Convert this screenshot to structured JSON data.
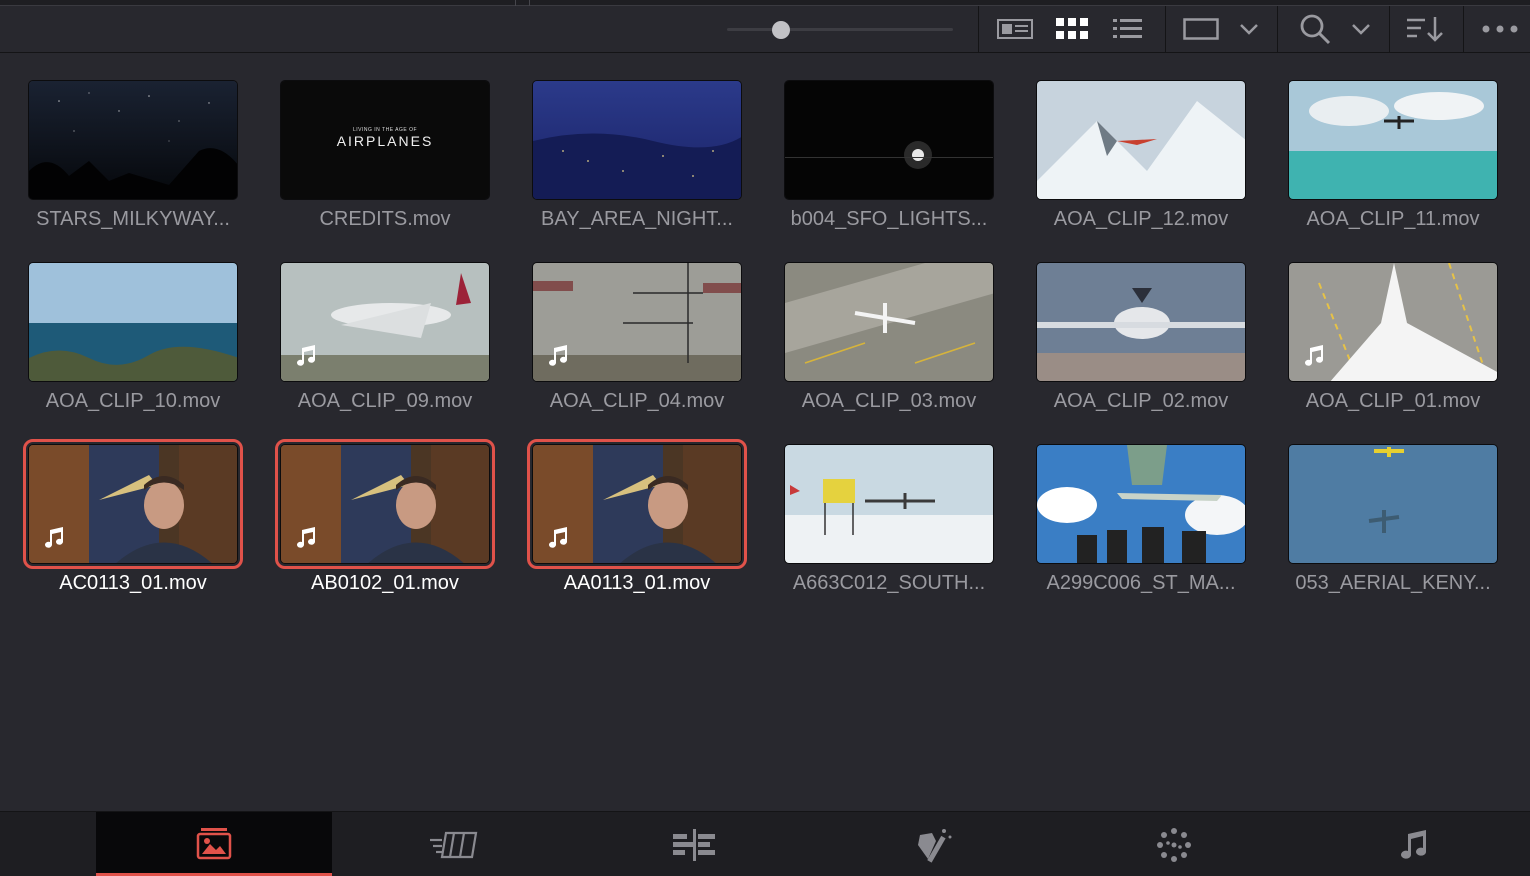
{
  "toolbar": {
    "zoom_slider_value": 0.25,
    "icons": [
      "metadata-view-icon",
      "thumbnail-view-icon",
      "list-view-icon",
      "clip-size-icon",
      "chevron-down-icon",
      "search-icon",
      "chevron-down-icon",
      "sort-icon",
      "more-options-icon"
    ]
  },
  "clips": [
    {
      "name": "STARS_MILKYWAY...",
      "audio": false,
      "selected": false,
      "scene": "night-stars"
    },
    {
      "name": "CREDITS.mov",
      "audio": false,
      "selected": false,
      "scene": "title-card",
      "title_small": "LIVING IN THE AGE OF",
      "title_big": "AIRPLANES"
    },
    {
      "name": "BAY_AREA_NIGHT...",
      "audio": false,
      "selected": false,
      "scene": "bay-night"
    },
    {
      "name": "b004_SFO_LIGHTS...",
      "audio": false,
      "selected": false,
      "scene": "dark-lights"
    },
    {
      "name": "AOA_CLIP_12.mov",
      "audio": false,
      "selected": false,
      "scene": "snow-plane"
    },
    {
      "name": "AOA_CLIP_11.mov",
      "audio": false,
      "selected": false,
      "scene": "ocean-plane"
    },
    {
      "name": "AOA_CLIP_10.mov",
      "audio": false,
      "selected": false,
      "scene": "underwater"
    },
    {
      "name": "AOA_CLIP_09.mov",
      "audio": true,
      "selected": false,
      "scene": "takeoff"
    },
    {
      "name": "AOA_CLIP_04.mov",
      "audio": true,
      "selected": false,
      "scene": "approach-lights"
    },
    {
      "name": "AOA_CLIP_03.mov",
      "audio": false,
      "selected": false,
      "scene": "aerial-runway"
    },
    {
      "name": "AOA_CLIP_02.mov",
      "audio": false,
      "selected": false,
      "scene": "a380-landing"
    },
    {
      "name": "AOA_CLIP_01.mov",
      "audio": true,
      "selected": false,
      "scene": "overhead-plane"
    },
    {
      "name": "AC0113_01.mov",
      "audio": true,
      "selected": true,
      "scene": "interview"
    },
    {
      "name": "AB0102_01.mov",
      "audio": true,
      "selected": true,
      "scene": "interview"
    },
    {
      "name": "AA0113_01.mov",
      "audio": true,
      "selected": true,
      "scene": "interview"
    },
    {
      "name": "A663C012_SOUTH...",
      "audio": false,
      "selected": false,
      "scene": "south-pole"
    },
    {
      "name": "A299C006_ST_MA...",
      "audio": false,
      "selected": false,
      "scene": "beach-crowd"
    },
    {
      "name": "053_AERIAL_KENY...",
      "audio": false,
      "selected": false,
      "scene": "aerial-blue"
    }
  ],
  "bottom_nav": [
    {
      "name": "media-page-icon",
      "active": true
    },
    {
      "name": "cut-page-icon",
      "active": false
    },
    {
      "name": "edit-page-icon",
      "active": false
    },
    {
      "name": "fusion-page-icon",
      "active": false
    },
    {
      "name": "color-page-icon",
      "active": false
    },
    {
      "name": "fairlight-page-icon",
      "active": false
    }
  ],
  "colors": {
    "background": "#28282e",
    "selection": "#e0524a",
    "text": "#9a9aa0",
    "text_selected": "#ffffff"
  }
}
